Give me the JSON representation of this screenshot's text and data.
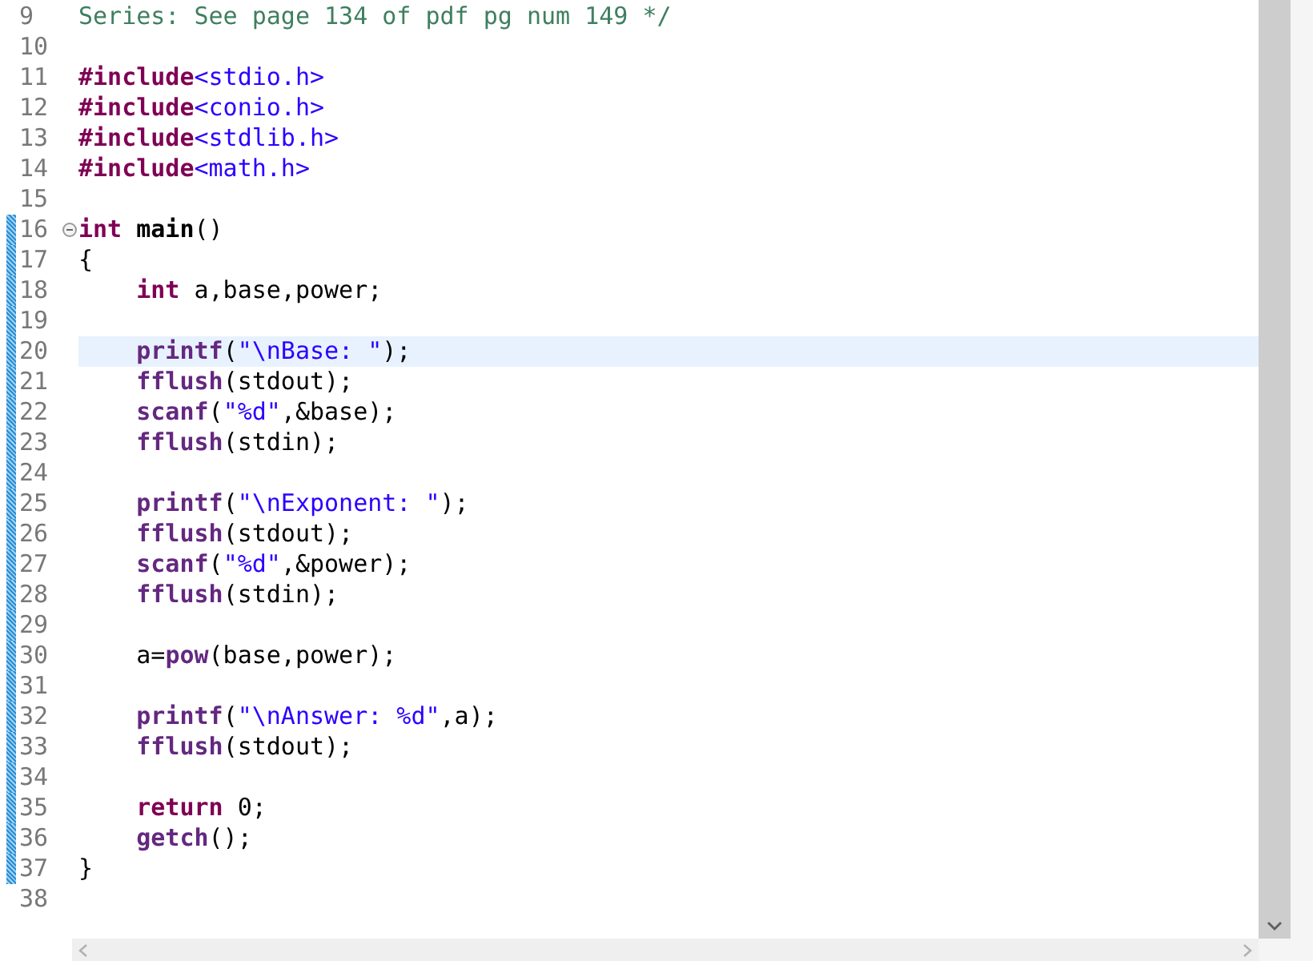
{
  "editor": {
    "lines": [
      {
        "number": "9",
        "changed": false,
        "current": false,
        "tokens": [
          {
            "kind": "comment",
            "text": "Series: See page 134 of pdf pg num 149 */"
          }
        ]
      },
      {
        "number": "10",
        "changed": false,
        "current": false
      },
      {
        "number": "11",
        "changed": false,
        "current": false,
        "tokens": [
          {
            "kind": "directive",
            "text": "#include"
          },
          {
            "kind": "string",
            "text": "<stdio.h>"
          }
        ]
      },
      {
        "number": "12",
        "changed": false,
        "current": false,
        "tokens": [
          {
            "kind": "directive",
            "text": "#include"
          },
          {
            "kind": "string",
            "text": "<conio.h>"
          }
        ]
      },
      {
        "number": "13",
        "changed": false,
        "current": false,
        "tokens": [
          {
            "kind": "directive",
            "text": "#include"
          },
          {
            "kind": "string",
            "text": "<stdlib.h>"
          }
        ]
      },
      {
        "number": "14",
        "changed": false,
        "current": false,
        "tokens": [
          {
            "kind": "directive",
            "text": "#include"
          },
          {
            "kind": "string",
            "text": "<math.h>"
          }
        ]
      },
      {
        "number": "15",
        "changed": false,
        "current": false
      },
      {
        "number": "16",
        "changed": true,
        "current": false,
        "expanded": true,
        "tokens": [
          {
            "kind": "keyword",
            "text": "int "
          },
          {
            "kind": "name",
            "text": "main"
          },
          {
            "kind": "plain",
            "text": "()"
          }
        ]
      },
      {
        "number": "17",
        "changed": true,
        "current": false,
        "tokens": [
          {
            "kind": "plain",
            "text": "{"
          }
        ]
      },
      {
        "number": "18",
        "changed": true,
        "current": false,
        "tokens": [
          {
            "kind": "keyword",
            "text": "    int"
          },
          {
            "kind": "plain",
            "text": " a,base,power;"
          }
        ]
      },
      {
        "number": "19",
        "changed": true,
        "current": false
      },
      {
        "number": "20",
        "changed": true,
        "current": true,
        "tokens": [
          {
            "kind": "function",
            "text": "    printf"
          },
          {
            "kind": "plain",
            "text": "("
          },
          {
            "kind": "string",
            "text": "\"\\nBase: \""
          },
          {
            "kind": "plain",
            "text": ");"
          }
        ]
      },
      {
        "number": "21",
        "changed": true,
        "current": false,
        "tokens": [
          {
            "kind": "function",
            "text": "    fflush"
          },
          {
            "kind": "plain",
            "text": "(stdout);"
          }
        ]
      },
      {
        "number": "22",
        "changed": true,
        "current": false,
        "tokens": [
          {
            "kind": "function",
            "text": "    scanf"
          },
          {
            "kind": "plain",
            "text": "("
          },
          {
            "kind": "string",
            "text": "\"%d\""
          },
          {
            "kind": "plain",
            "text": ",&base);"
          }
        ]
      },
      {
        "number": "23",
        "changed": true,
        "current": false,
        "tokens": [
          {
            "kind": "function",
            "text": "    fflush"
          },
          {
            "kind": "plain",
            "text": "(stdin);"
          }
        ]
      },
      {
        "number": "24",
        "changed": true,
        "current": false
      },
      {
        "number": "25",
        "changed": true,
        "current": false,
        "tokens": [
          {
            "kind": "function",
            "text": "    printf"
          },
          {
            "kind": "plain",
            "text": "("
          },
          {
            "kind": "string",
            "text": "\"\\nExponent: \""
          },
          {
            "kind": "plain",
            "text": ");"
          }
        ]
      },
      {
        "number": "26",
        "changed": true,
        "current": false,
        "tokens": [
          {
            "kind": "function",
            "text": "    fflush"
          },
          {
            "kind": "plain",
            "text": "(stdout);"
          }
        ]
      },
      {
        "number": "27",
        "changed": true,
        "current": false,
        "tokens": [
          {
            "kind": "function",
            "text": "    scanf"
          },
          {
            "kind": "plain",
            "text": "("
          },
          {
            "kind": "string",
            "text": "\"%d\""
          },
          {
            "kind": "plain",
            "text": ",&power);"
          }
        ]
      },
      {
        "number": "28",
        "changed": true,
        "current": false,
        "tokens": [
          {
            "kind": "function",
            "text": "    fflush"
          },
          {
            "kind": "plain",
            "text": "(stdin);"
          }
        ]
      },
      {
        "number": "29",
        "changed": true,
        "current": false
      },
      {
        "number": "30",
        "changed": true,
        "current": false,
        "tokens": [
          {
            "kind": "plain",
            "text": "    a="
          },
          {
            "kind": "function",
            "text": "pow"
          },
          {
            "kind": "plain",
            "text": "(base,power);"
          }
        ]
      },
      {
        "number": "31",
        "changed": true,
        "current": false
      },
      {
        "number": "32",
        "changed": true,
        "current": false,
        "tokens": [
          {
            "kind": "function",
            "text": "    printf"
          },
          {
            "kind": "plain",
            "text": "("
          },
          {
            "kind": "string",
            "text": "\"\\nAnswer: %d\""
          },
          {
            "kind": "plain",
            "text": ",a);"
          }
        ]
      },
      {
        "number": "33",
        "changed": true,
        "current": false,
        "tokens": [
          {
            "kind": "function",
            "text": "    fflush"
          },
          {
            "kind": "plain",
            "text": "(stdout);"
          }
        ]
      },
      {
        "number": "34",
        "changed": true,
        "current": false
      },
      {
        "number": "35",
        "changed": true,
        "current": false,
        "tokens": [
          {
            "kind": "keyword",
            "text": "    return"
          },
          {
            "kind": "plain",
            "text": " 0;"
          }
        ]
      },
      {
        "number": "36",
        "changed": true,
        "current": false,
        "tokens": [
          {
            "kind": "function",
            "text": "    getch"
          },
          {
            "kind": "plain",
            "text": "();"
          }
        ]
      },
      {
        "number": "37",
        "changed": true,
        "current": false,
        "tokens": [
          {
            "kind": "plain",
            "text": "}"
          }
        ]
      },
      {
        "number": "38",
        "changed": false,
        "current": false
      }
    ]
  }
}
